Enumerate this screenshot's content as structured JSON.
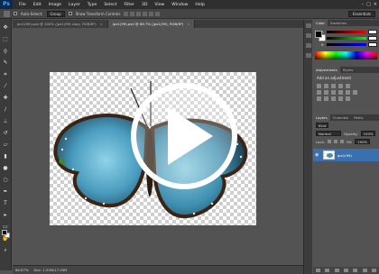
{
  "app": {
    "logo": "Ps"
  },
  "menubar": {
    "items": [
      "File",
      "Edit",
      "Image",
      "Layer",
      "Type",
      "Select",
      "Filter",
      "3D",
      "View",
      "Window",
      "Help"
    ],
    "controls": [
      "–",
      "□",
      "×"
    ]
  },
  "options": {
    "auto_select_label": "Auto-Select:",
    "auto_select_value": "Group",
    "show_transform_label": "Show Transform Controls",
    "workspace": "Essentials"
  },
  "tabs": [
    {
      "label": "jpx1(99).psd @ 100% (jpx1(99) copy, RGB/8*)",
      "active": false
    },
    {
      "label": "jpx1(99).psd @ 66.7% (jpx1(99), RGB/8*)",
      "active": true
    }
  ],
  "status": {
    "zoom": "66.67%",
    "doc": "Doc: 1.09M/17.09M"
  },
  "panels": {
    "color_tabs": [
      "Color",
      "Swatches"
    ],
    "color_channels": [
      "R",
      "G",
      "B"
    ],
    "adjust_tabs": [
      "Adjustments",
      "Styles"
    ],
    "adjust_title": "Add an adjustment",
    "layers_tabs": [
      "Layers",
      "Channels",
      "Paths"
    ],
    "kind_label": "Kind",
    "blend_mode": "Normal",
    "opacity_label": "Opacity:",
    "opacity_value": "100%",
    "lock_label": "Lock:",
    "fill_label": "Fill:",
    "fill_value": "100%",
    "layer_name": "jpx1(99)"
  },
  "icons": {
    "tools": [
      "move-icon",
      "marquee-icon",
      "lasso-icon",
      "quick-select-icon",
      "crop-icon",
      "eyedropper-icon",
      "healing-icon",
      "brush-icon",
      "stamp-icon",
      "history-brush-icon",
      "eraser-icon",
      "gradient-icon",
      "blur-icon",
      "dodge-icon",
      "pen-icon",
      "type-icon",
      "path-select-icon",
      "shape-icon",
      "hand-icon",
      "zoom-icon"
    ],
    "overlay": "play-icon"
  },
  "colors": {
    "ps_logo_bg": "#0a2a52",
    "ps_logo_fg": "#4fa9ff",
    "selected_layer": "#3a6fb0",
    "butterfly_blue": "#5aa9c8"
  }
}
